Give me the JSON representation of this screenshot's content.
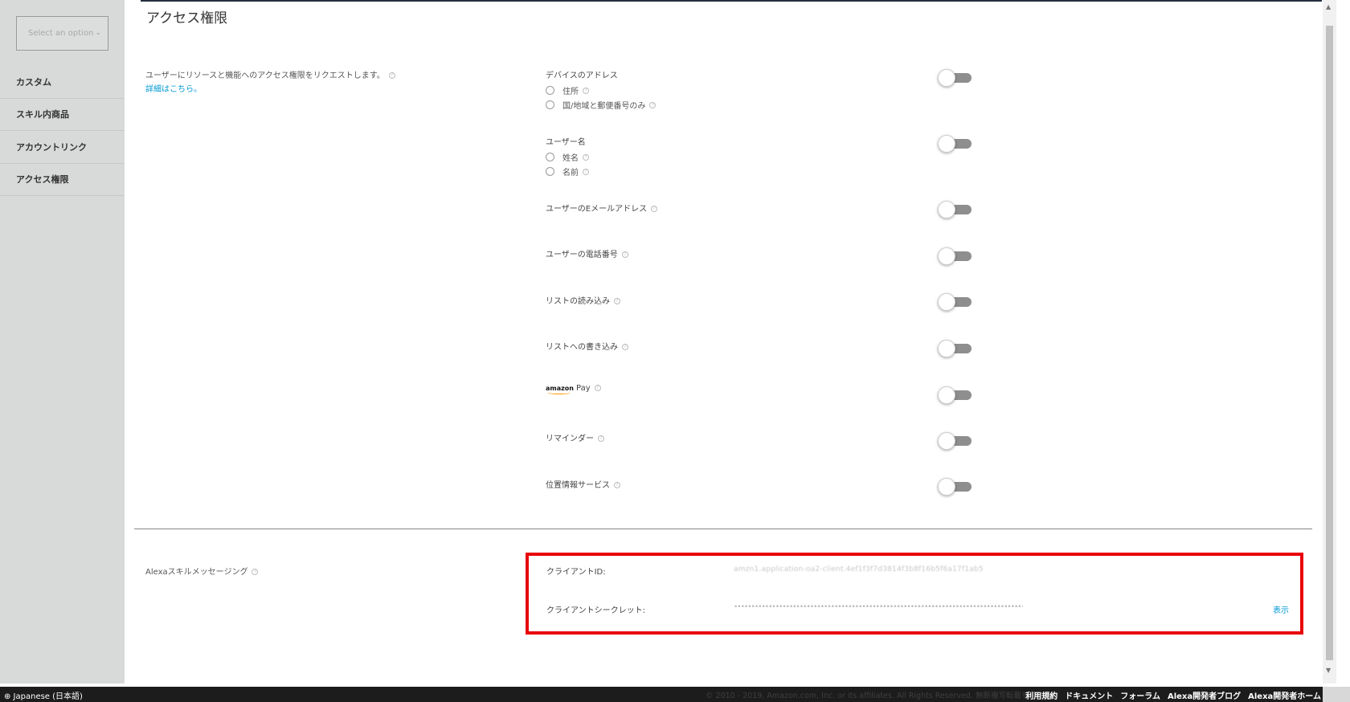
{
  "sidebar": {
    "select_placeholder": "Select an option",
    "items": [
      {
        "label": "カスタム"
      },
      {
        "label": "スキル内商品"
      },
      {
        "label": "アカウントリンク"
      },
      {
        "label": "アクセス権限"
      }
    ]
  },
  "main": {
    "title": "アクセス権限",
    "description": "ユーザーにリソースと機能へのアクセス権限をリクエストします。",
    "learn_more": "詳細はこちら。",
    "permissions": [
      {
        "label": "デバイスのアドレス",
        "options": [
          "住所",
          "国/地域と郵便番号のみ"
        ],
        "enabled": false
      },
      {
        "label": "ユーザー名",
        "options": [
          "姓名",
          "名前"
        ],
        "enabled": false
      },
      {
        "label": "ユーザーのEメールアドレス",
        "enabled": false
      },
      {
        "label": "ユーザーの電話番号",
        "enabled": false
      },
      {
        "label": "リストの読み込み",
        "enabled": false
      },
      {
        "label": "リストへの書き込み",
        "enabled": false
      },
      {
        "label": "Pay",
        "logo_text": "amazon",
        "enabled": false
      },
      {
        "label": "リマインダー",
        "enabled": false
      },
      {
        "label": "位置情報サービス",
        "enabled": false
      }
    ],
    "messaging": {
      "label": "Alexaスキルメッセージング",
      "client_id_label": "クライアントID:",
      "client_id_value": "amzn1.application-oa2-client.4ef1f3f7d3814f3b8f16b5f6a17f1ab5",
      "client_secret_label": "クライアントシークレット:",
      "client_secret_value": "••••••••••••••••••••••••••••••••••••••••••••••••••••••••••••••••••••••••••••••••••••••••••••••••••",
      "show_label": "表示"
    }
  },
  "footer": {
    "language": "⊕ Japanese (日本語)",
    "copyright": "© 2010 - 2019, Amazon.com, Inc. or its affiliates. All Rights Reserved. 無断複写転載を禁じます",
    "links": [
      "利用規約",
      "ドキュメント",
      "フォーラム",
      "Alexa開発者ブログ",
      "Alexa開発者ホーム"
    ]
  },
  "colors": {
    "accent_link": "#0099d4",
    "highlight_border": "#e8040b",
    "sidebar_bg": "#d8d9d9",
    "footer_bg": "#1c1c1c"
  }
}
